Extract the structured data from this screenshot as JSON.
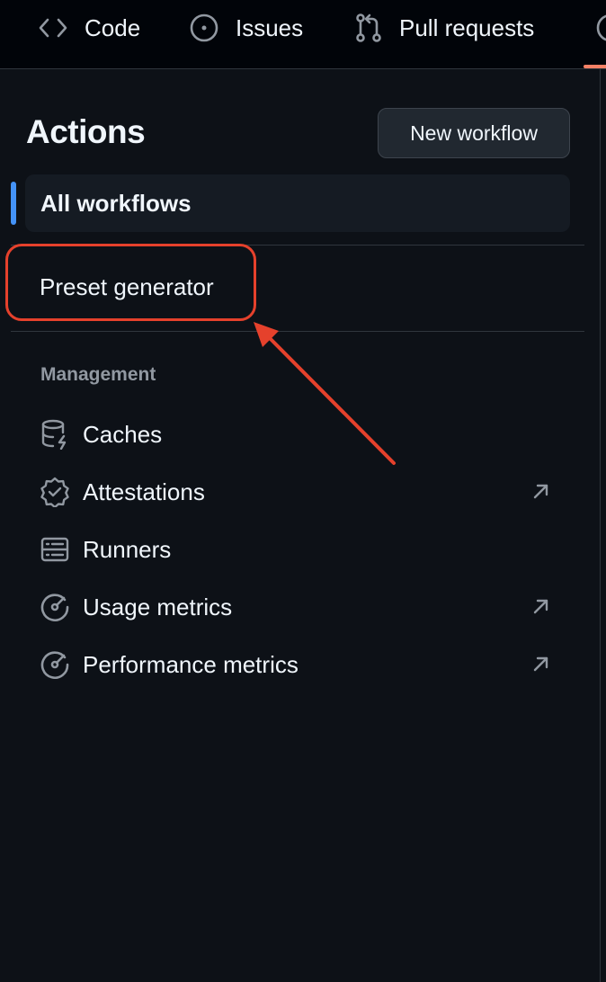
{
  "nav": {
    "tabs": [
      {
        "label": "Code",
        "icon": "code-icon"
      },
      {
        "label": "Issues",
        "icon": "issue-opened-icon"
      },
      {
        "label": "Pull requests",
        "icon": "git-pull-request-icon"
      }
    ]
  },
  "sidebar": {
    "title": "Actions",
    "new_workflow_label": "New workflow",
    "all_workflows_label": "All workflows",
    "workflows": [
      {
        "label": "Preset generator"
      }
    ],
    "management_heading": "Management",
    "management_items": [
      {
        "label": "Caches",
        "icon": "database-icon",
        "external": false
      },
      {
        "label": "Attestations",
        "icon": "verified-icon",
        "external": true
      },
      {
        "label": "Runners",
        "icon": "server-icon",
        "external": false
      },
      {
        "label": "Usage metrics",
        "icon": "meter-icon",
        "external": true
      },
      {
        "label": "Performance metrics",
        "icon": "meter-icon",
        "external": true
      }
    ]
  },
  "colors": {
    "background": "#0d1117",
    "nav_background": "#010409",
    "accent_blue": "#4493f8",
    "annotation_red": "#e5412c",
    "muted_text": "#9198a1"
  }
}
